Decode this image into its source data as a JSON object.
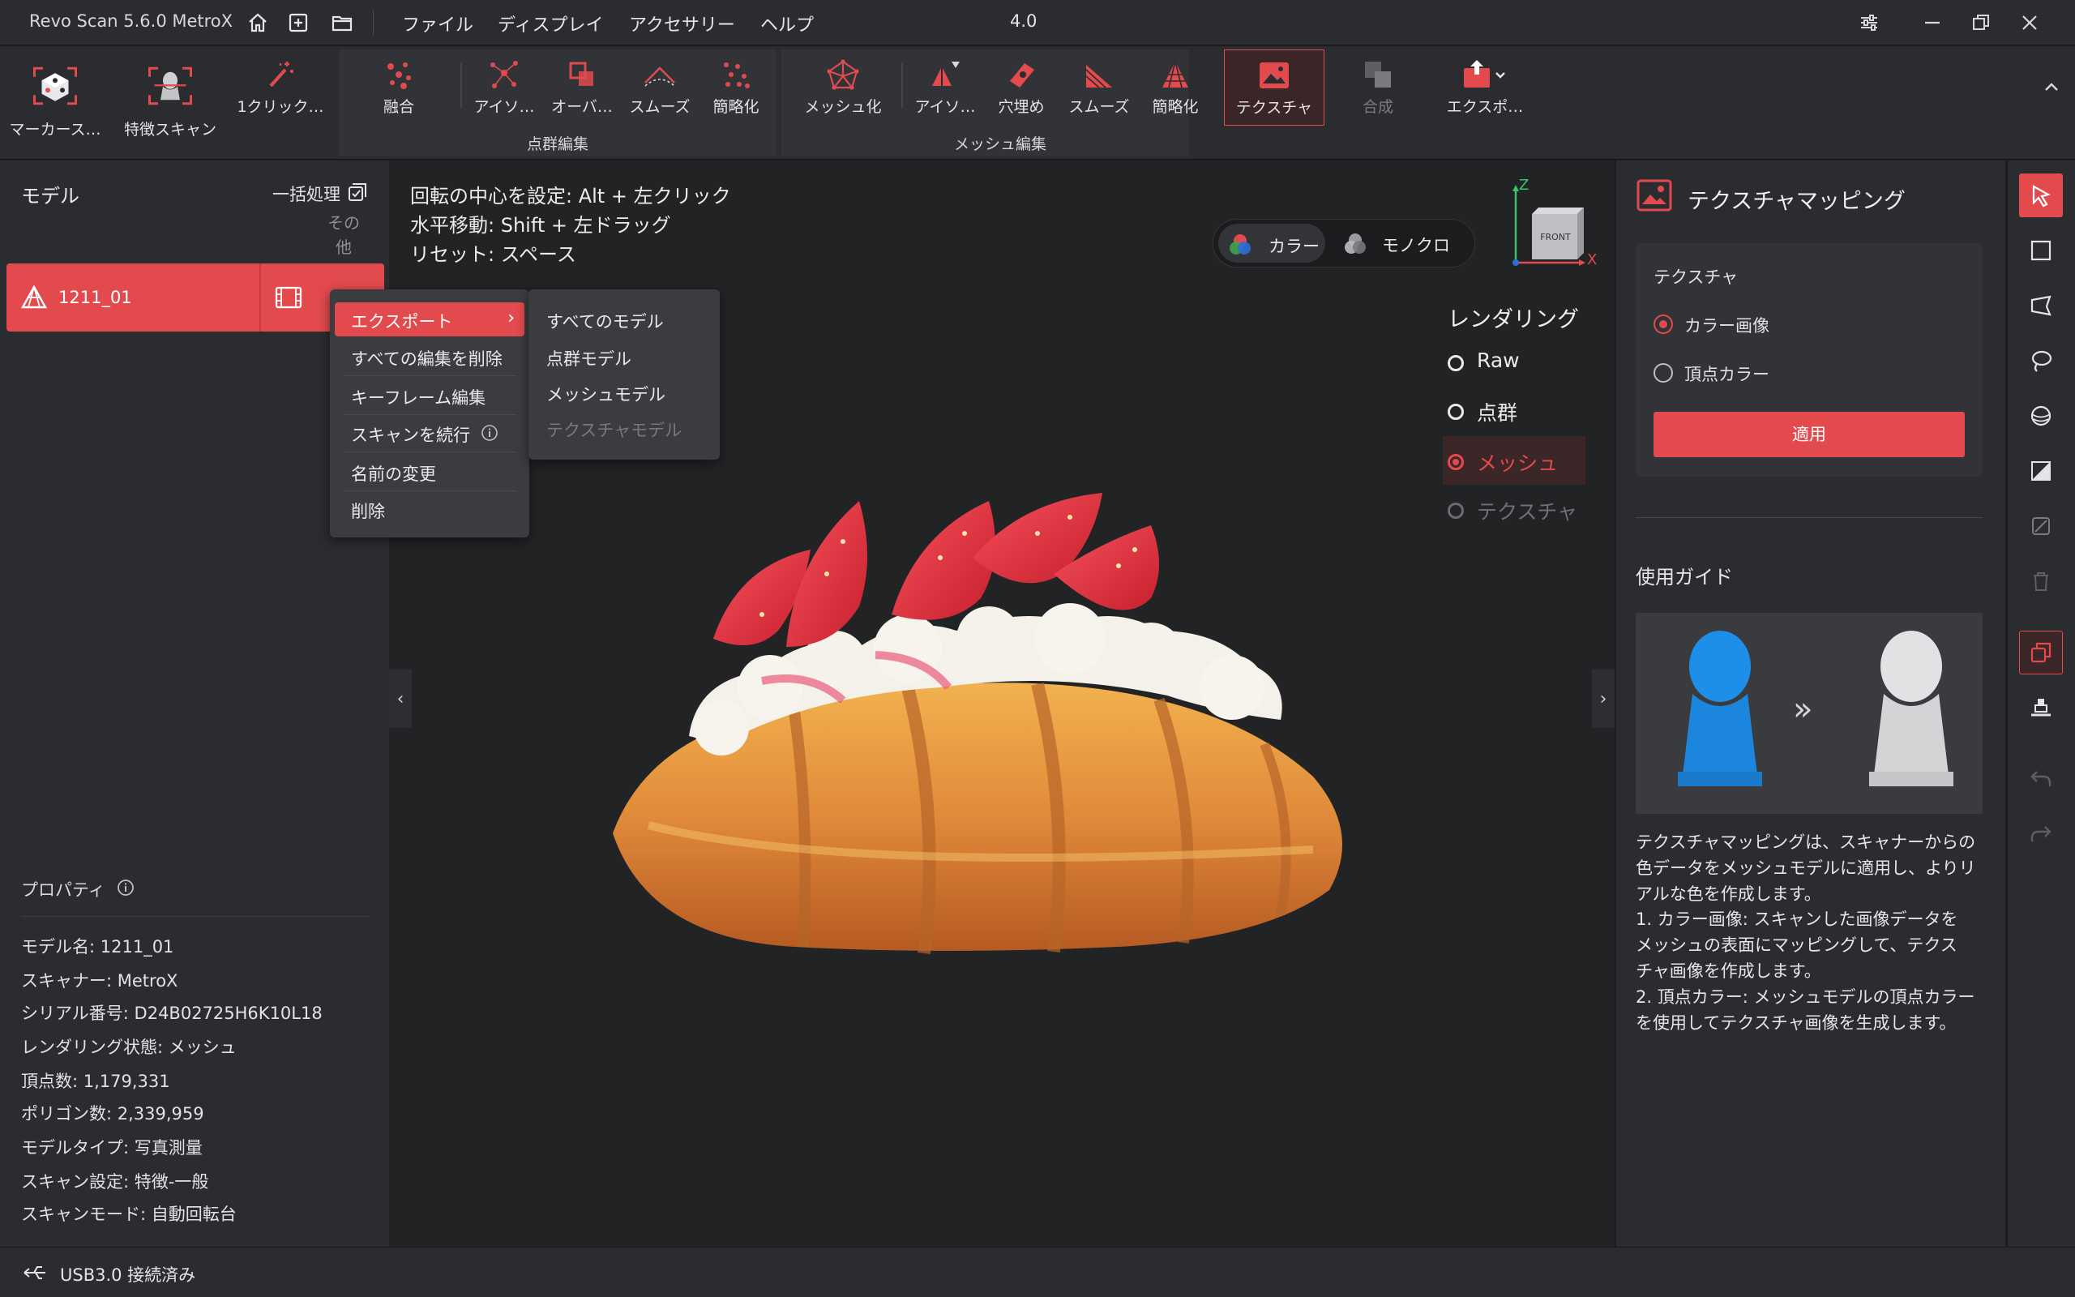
{
  "app": {
    "title": "Revo Scan 5.6.0 MetroX",
    "zoom_label": "4.0"
  },
  "menu": [
    "ファイル",
    "ディスプレイ",
    "アクセサリー",
    "ヘルプ"
  ],
  "toolbar": {
    "marker_scan": "マーカース…",
    "feature_scan": "特徴スキャン",
    "one_click": "1クリック…",
    "point_cloud": {
      "fuse": "融合",
      "isolate": "アイソ…",
      "overlap": "オーバ…",
      "smooth": "スムーズ",
      "simplify": "簡略化",
      "group_label": "点群編集"
    },
    "mesh": {
      "meshing": "メッシュ化",
      "isolate": "アイソ…",
      "fill_holes": "穴埋め",
      "smooth": "スムーズ",
      "simplify": "簡略化",
      "group_label": "メッシュ編集"
    },
    "texture": "テクスチャ",
    "merge": "合成",
    "export": "エクスポ…"
  },
  "left_panel": {
    "title": "モデル",
    "batch": "一括処理",
    "other_1": "その",
    "other_2": "他",
    "model_name": "1211_01",
    "properties_title": "プロパティ",
    "properties": [
      "モデル名:  1211_01",
      "スキャナー:  MetroX",
      "シリアル番号:  D24B02725H6K10L18",
      "レンダリング状態:  メッシュ",
      "頂点数:  1,179,331",
      "ポリゴン数:  2,339,959",
      "モデルタイプ:  写真測量",
      "スキャン設定:  特徴-一般",
      "スキャンモード:  自動回転台"
    ]
  },
  "context_menu": {
    "items": [
      "エクスポート",
      "すべての編集を削除",
      "キーフレーム編集",
      "スキャンを続行",
      "名前の変更",
      "削除"
    ],
    "submenu": [
      "すべてのモデル",
      "点群モデル",
      "メッシュモデル",
      "テクスチャモデル"
    ]
  },
  "viewport": {
    "hints": [
      "回転の中心を設定: Alt + 左クリック",
      "水平移動: Shift + 左ドラッグ",
      "リセット: スペース"
    ],
    "color_mode": "カラー",
    "mono_mode": "モノクロ",
    "axis_z": "Z",
    "axis_x": "X",
    "cube_front": "FRONT",
    "rendering_title": "レンダリング",
    "rendering_options": [
      "Raw",
      "点群",
      "メッシュ",
      "テクスチャ"
    ],
    "rendering_selected": "メッシュ"
  },
  "right_panel": {
    "title": "テクスチャマッピング",
    "texture_label": "テクスチャ",
    "option_color_image": "カラー画像",
    "option_vertex_color": "頂点カラー",
    "apply_button": "適用",
    "guide_title": "使用ガイド",
    "guide_arrow": "»",
    "guide_text": [
      "テクスチャマッピングは、スキャナーからの",
      "色データをメッシュモデルに適用し、よりリ",
      "アルな色を作成します。",
      "1. カラー画像: スキャンした画像データを",
      "メッシュの表面にマッピングして、テクス",
      "チャ画像を作成します。",
      "2. 頂点カラー: メッシュモデルの頂点カラー",
      "を使用してテクスチャ画像を生成します。"
    ]
  },
  "status": {
    "connection": "USB3.0 接続済み"
  },
  "colors": {
    "accent": "#e24a4e",
    "panel": "#2b2c2f",
    "viewport": "#222325"
  }
}
